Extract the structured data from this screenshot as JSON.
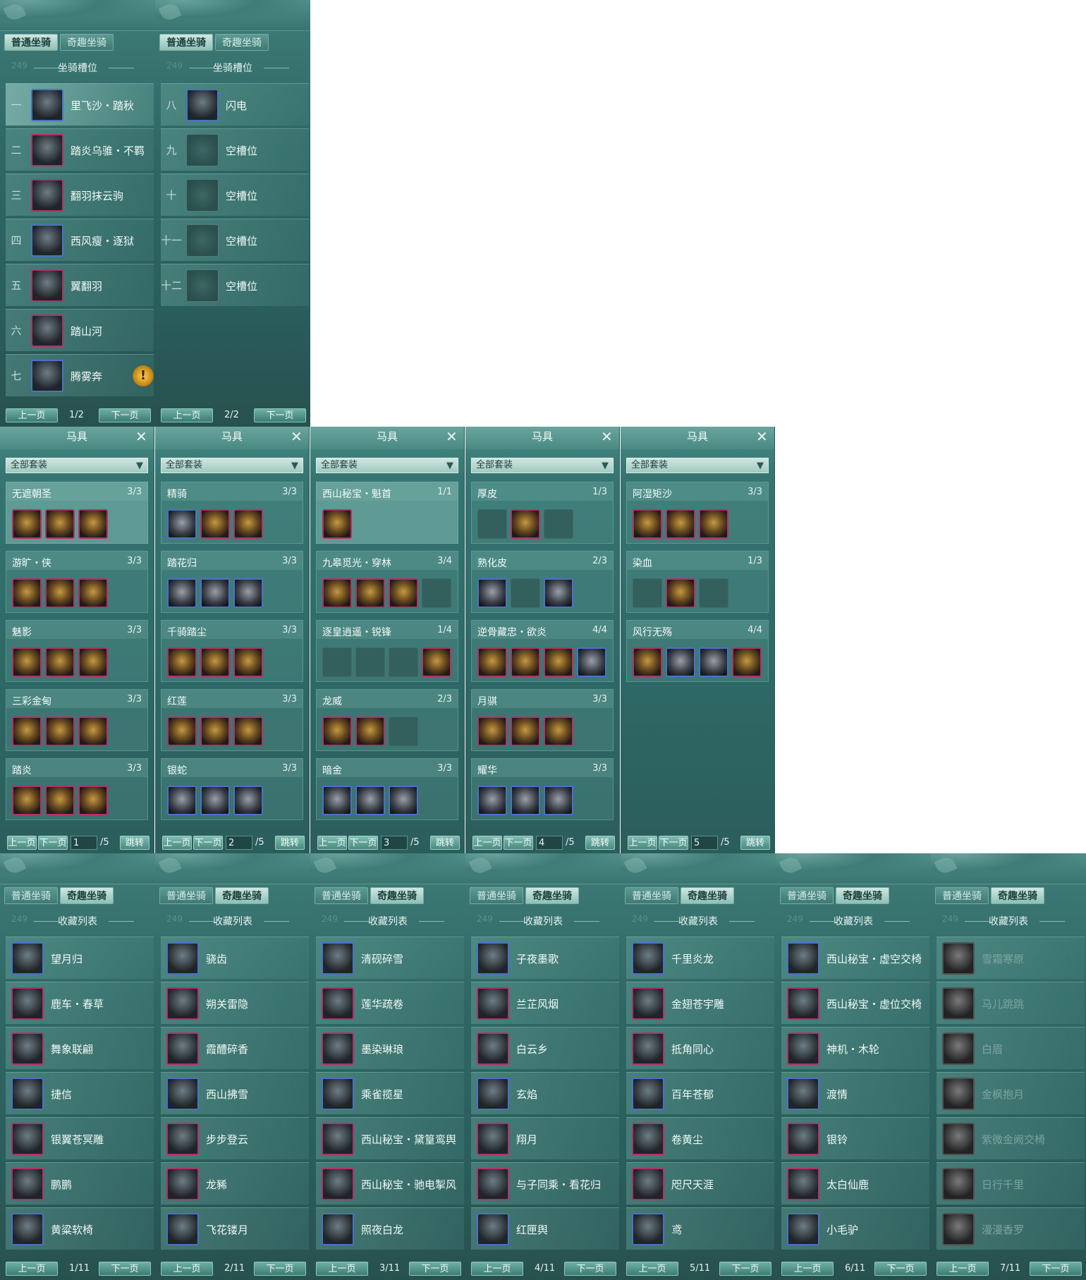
{
  "slot_panels": [
    {
      "tabs": [
        "普通坐骑",
        "奇趣坐骑"
      ],
      "active_tab": 0,
      "section": "坐骑槽位",
      "ghost": "249",
      "rows": [
        {
          "n": "一",
          "name": "里飞沙・踏秋",
          "state": "horse"
        },
        {
          "n": "二",
          "name": "踏炎乌骓・不羁",
          "state": "horse"
        },
        {
          "n": "三",
          "name": "翻羽抹云驹",
          "state": "horse"
        },
        {
          "n": "四",
          "name": "西风瘦・逐狱",
          "state": "horse"
        },
        {
          "n": "五",
          "name": "翼翻羽",
          "state": "horse"
        },
        {
          "n": "六",
          "name": "踏山河",
          "state": "horse"
        },
        {
          "n": "七",
          "name": "腾雾奔",
          "state": "horse"
        }
      ],
      "pager": {
        "prev": "上一页",
        "page": "1/2",
        "next": "下一页"
      }
    },
    {
      "tabs": [
        "普通坐骑",
        "奇趣坐骑"
      ],
      "active_tab": 0,
      "section": "坐骑槽位",
      "ghost": "249",
      "rows": [
        {
          "n": "八",
          "name": "闪电",
          "state": "horse"
        },
        {
          "n": "九",
          "name": "空槽位",
          "state": "empty"
        },
        {
          "n": "十",
          "name": "空槽位",
          "state": "empty"
        },
        {
          "n": "十一",
          "name": "空槽位",
          "state": "empty"
        },
        {
          "n": "十二",
          "name": "空槽位",
          "state": "empty"
        }
      ],
      "pager": {
        "prev": "上一页",
        "page": "2/2",
        "next": "下一页"
      }
    }
  ],
  "warn_glyph": "!",
  "tack_panels": [
    {
      "title": "马具",
      "close": "✕",
      "filter": "全部套装",
      "filter_arrow": "▼",
      "sets": [
        {
          "name": "无遮朝圣",
          "count": "3/3",
          "items": [
            "r",
            "r",
            "r"
          ]
        },
        {
          "name": "游旷・侠",
          "count": "3/3",
          "items": [
            "r",
            "r",
            "r"
          ]
        },
        {
          "name": "魅影",
          "count": "3/3",
          "items": [
            "r",
            "r",
            "r"
          ]
        },
        {
          "name": "三彩金甸",
          "count": "3/3",
          "items": [
            "r",
            "r",
            "r"
          ]
        },
        {
          "name": "踏炎",
          "count": "3/3",
          "items": [
            "r",
            "r",
            "r"
          ]
        }
      ],
      "pager": {
        "prev": "上一页",
        "next": "下一页",
        "page": "1",
        "total": "/5",
        "jump": "跳转"
      }
    },
    {
      "title": "马具",
      "close": "✕",
      "filter": "全部套装",
      "filter_arrow": "▼",
      "sets": [
        {
          "name": "精骑",
          "count": "3/3",
          "items": [
            "b",
            "r",
            "r"
          ]
        },
        {
          "name": "踏花归",
          "count": "3/3",
          "items": [
            "b",
            "b",
            "b"
          ]
        },
        {
          "name": "千骑踏尘",
          "count": "3/3",
          "items": [
            "r",
            "r",
            "r"
          ]
        },
        {
          "name": "红莲",
          "count": "3/3",
          "items": [
            "r",
            "r",
            "r"
          ]
        },
        {
          "name": "银蛇",
          "count": "3/3",
          "items": [
            "b",
            "b",
            "b"
          ]
        }
      ],
      "pager": {
        "prev": "上一页",
        "next": "下一页",
        "page": "2",
        "total": "/5",
        "jump": "跳转"
      }
    },
    {
      "title": "马具",
      "close": "✕",
      "filter": "全部套装",
      "filter_arrow": "▼",
      "sets": [
        {
          "name": "西山秘宝・魁首",
          "count": "1/1",
          "items": [
            "r"
          ]
        },
        {
          "name": "九皋觅光・穿林",
          "count": "3/4",
          "items": [
            "r",
            "r",
            "r",
            "s"
          ]
        },
        {
          "name": "逐皇逍遥・锐锋",
          "count": "1/4",
          "items": [
            "s",
            "s",
            "s",
            "r"
          ]
        },
        {
          "name": "龙威",
          "count": "2/3",
          "items": [
            "r",
            "r",
            "s"
          ]
        },
        {
          "name": "暗金",
          "count": "3/3",
          "items": [
            "b",
            "b",
            "b"
          ]
        }
      ],
      "pager": {
        "prev": "上一页",
        "next": "下一页",
        "page": "3",
        "total": "/5",
        "jump": "跳转"
      }
    },
    {
      "title": "马具",
      "close": "✕",
      "filter": "全部套装",
      "filter_arrow": "▼",
      "sets": [
        {
          "name": "厚皮",
          "count": "1/3",
          "items": [
            "s",
            "r",
            "s"
          ]
        },
        {
          "name": "熟化皮",
          "count": "2/3",
          "items": [
            "b",
            "s",
            "b"
          ]
        },
        {
          "name": "逆骨藏忠・欲炎",
          "count": "4/4",
          "items": [
            "r",
            "r",
            "r",
            "b"
          ]
        },
        {
          "name": "月骐",
          "count": "3/3",
          "items": [
            "r",
            "r",
            "r"
          ]
        },
        {
          "name": "耀华",
          "count": "3/3",
          "items": [
            "b",
            "b",
            "b"
          ]
        }
      ],
      "pager": {
        "prev": "上一页",
        "next": "下一页",
        "page": "4",
        "total": "/5",
        "jump": "跳转"
      }
    },
    {
      "title": "马具",
      "close": "✕",
      "filter": "全部套装",
      "filter_arrow": "▼",
      "sets": [
        {
          "name": "阿湿矩沙",
          "count": "3/3",
          "items": [
            "r",
            "r",
            "r"
          ]
        },
        {
          "name": "染血",
          "count": "1/3",
          "items": [
            "s",
            "r",
            "s"
          ]
        },
        {
          "name": "风行无殇",
          "count": "4/4",
          "items": [
            "r",
            "b",
            "b",
            "r"
          ]
        }
      ],
      "pager": {
        "prev": "上一页",
        "next": "下一页",
        "page": "5",
        "total": "/5",
        "jump": "跳转"
      }
    }
  ],
  "collection_panels": [
    {
      "tabs": [
        "普通坐骑",
        "奇趣坐骑"
      ],
      "active_tab": 1,
      "section": "收藏列表",
      "ghost": "249",
      "items": [
        "望月归",
        "鹿车・春草",
        "舞象联翩",
        "捷信",
        "银翼苍冥雕",
        "鹏鹏",
        "黄粱软椅"
      ],
      "grey": false,
      "pager": {
        "prev": "上一页",
        "page": "1/11",
        "next": "下一页"
      }
    },
    {
      "tabs": [
        "普通坐骑",
        "奇趣坐骑"
      ],
      "active_tab": 1,
      "section": "收藏列表",
      "ghost": "249",
      "items": [
        "骁齿",
        "朔关雷隐",
        "霞醴碎香",
        "西山拂雪",
        "步步登云",
        "龙豨",
        "飞花镂月"
      ],
      "grey": false,
      "pager": {
        "prev": "上一页",
        "page": "2/11",
        "next": "下一页"
      }
    },
    {
      "tabs": [
        "普通坐骑",
        "奇趣坐骑"
      ],
      "active_tab": 1,
      "section": "收藏列表",
      "ghost": "249",
      "items": [
        "清砚碎雪",
        "莲华疏卷",
        "墨染琳琅",
        "乘雀揽星",
        "西山秘宝・黛篁鸾舆",
        "西山秘宝・驰电掣风",
        "照夜白龙"
      ],
      "grey": false,
      "pager": {
        "prev": "上一页",
        "page": "3/11",
        "next": "下一页"
      }
    },
    {
      "tabs": [
        "普通坐骑",
        "奇趣坐骑"
      ],
      "active_tab": 1,
      "section": "收藏列表",
      "ghost": "249",
      "items": [
        "子夜墨歌",
        "兰芷风烟",
        "白云乡",
        "玄焰",
        "翔月",
        "与子同乘・看花归",
        "红匣舆"
      ],
      "grey": false,
      "pager": {
        "prev": "上一页",
        "page": "4/11",
        "next": "下一页"
      }
    },
    {
      "tabs": [
        "普通坐骑",
        "奇趣坐骑"
      ],
      "active_tab": 1,
      "section": "收藏列表",
      "ghost": "249",
      "items": [
        "千里炎龙",
        "金翅苍宇雕",
        "抵角同心",
        "百年苍郁",
        "卷黄尘",
        "咫尺天涯",
        "鸢"
      ],
      "grey": false,
      "pager": {
        "prev": "上一页",
        "page": "5/11",
        "next": "下一页"
      }
    },
    {
      "tabs": [
        "普通坐骑",
        "奇趣坐骑"
      ],
      "active_tab": 1,
      "section": "收藏列表",
      "ghost": "249",
      "items": [
        "西山秘宝・虚空交椅",
        "西山秘宝・虚位交椅",
        "神机・木轮",
        "渡情",
        "银铃",
        "太白仙鹿",
        "小毛驴"
      ],
      "grey": false,
      "pager": {
        "prev": "上一页",
        "page": "6/11",
        "next": "下一页"
      }
    },
    {
      "tabs": [
        "普通坐骑",
        "奇趣坐骑"
      ],
      "active_tab": 1,
      "section": "收藏列表",
      "ghost": "249",
      "items": [
        "雪霜寒原",
        "马儿跳跳",
        "白眉",
        "金枫抱月",
        "紫微金阙交椅",
        "日行千里",
        "漫漫香罗"
      ],
      "grey": true,
      "pager": {
        "prev": "上一页",
        "page": "7/11",
        "next": "下一页"
      }
    }
  ],
  "colors": {
    "accent": "#3f7c78",
    "frame_red": "#b3306a",
    "frame_blue": "#4a72c8"
  }
}
